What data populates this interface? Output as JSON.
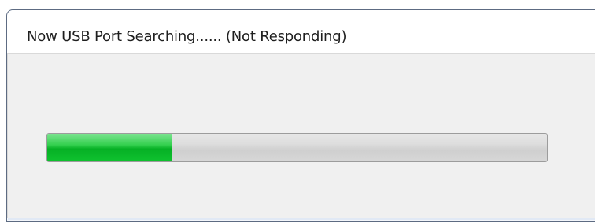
{
  "window": {
    "title": "Now USB Port Searching...... (Not Responding)"
  },
  "progress": {
    "value": 0.25
  },
  "colors": {
    "progress_fill": "#06b025",
    "progress_track": "#dcdcdc",
    "client_background": "#f0f0f0"
  }
}
